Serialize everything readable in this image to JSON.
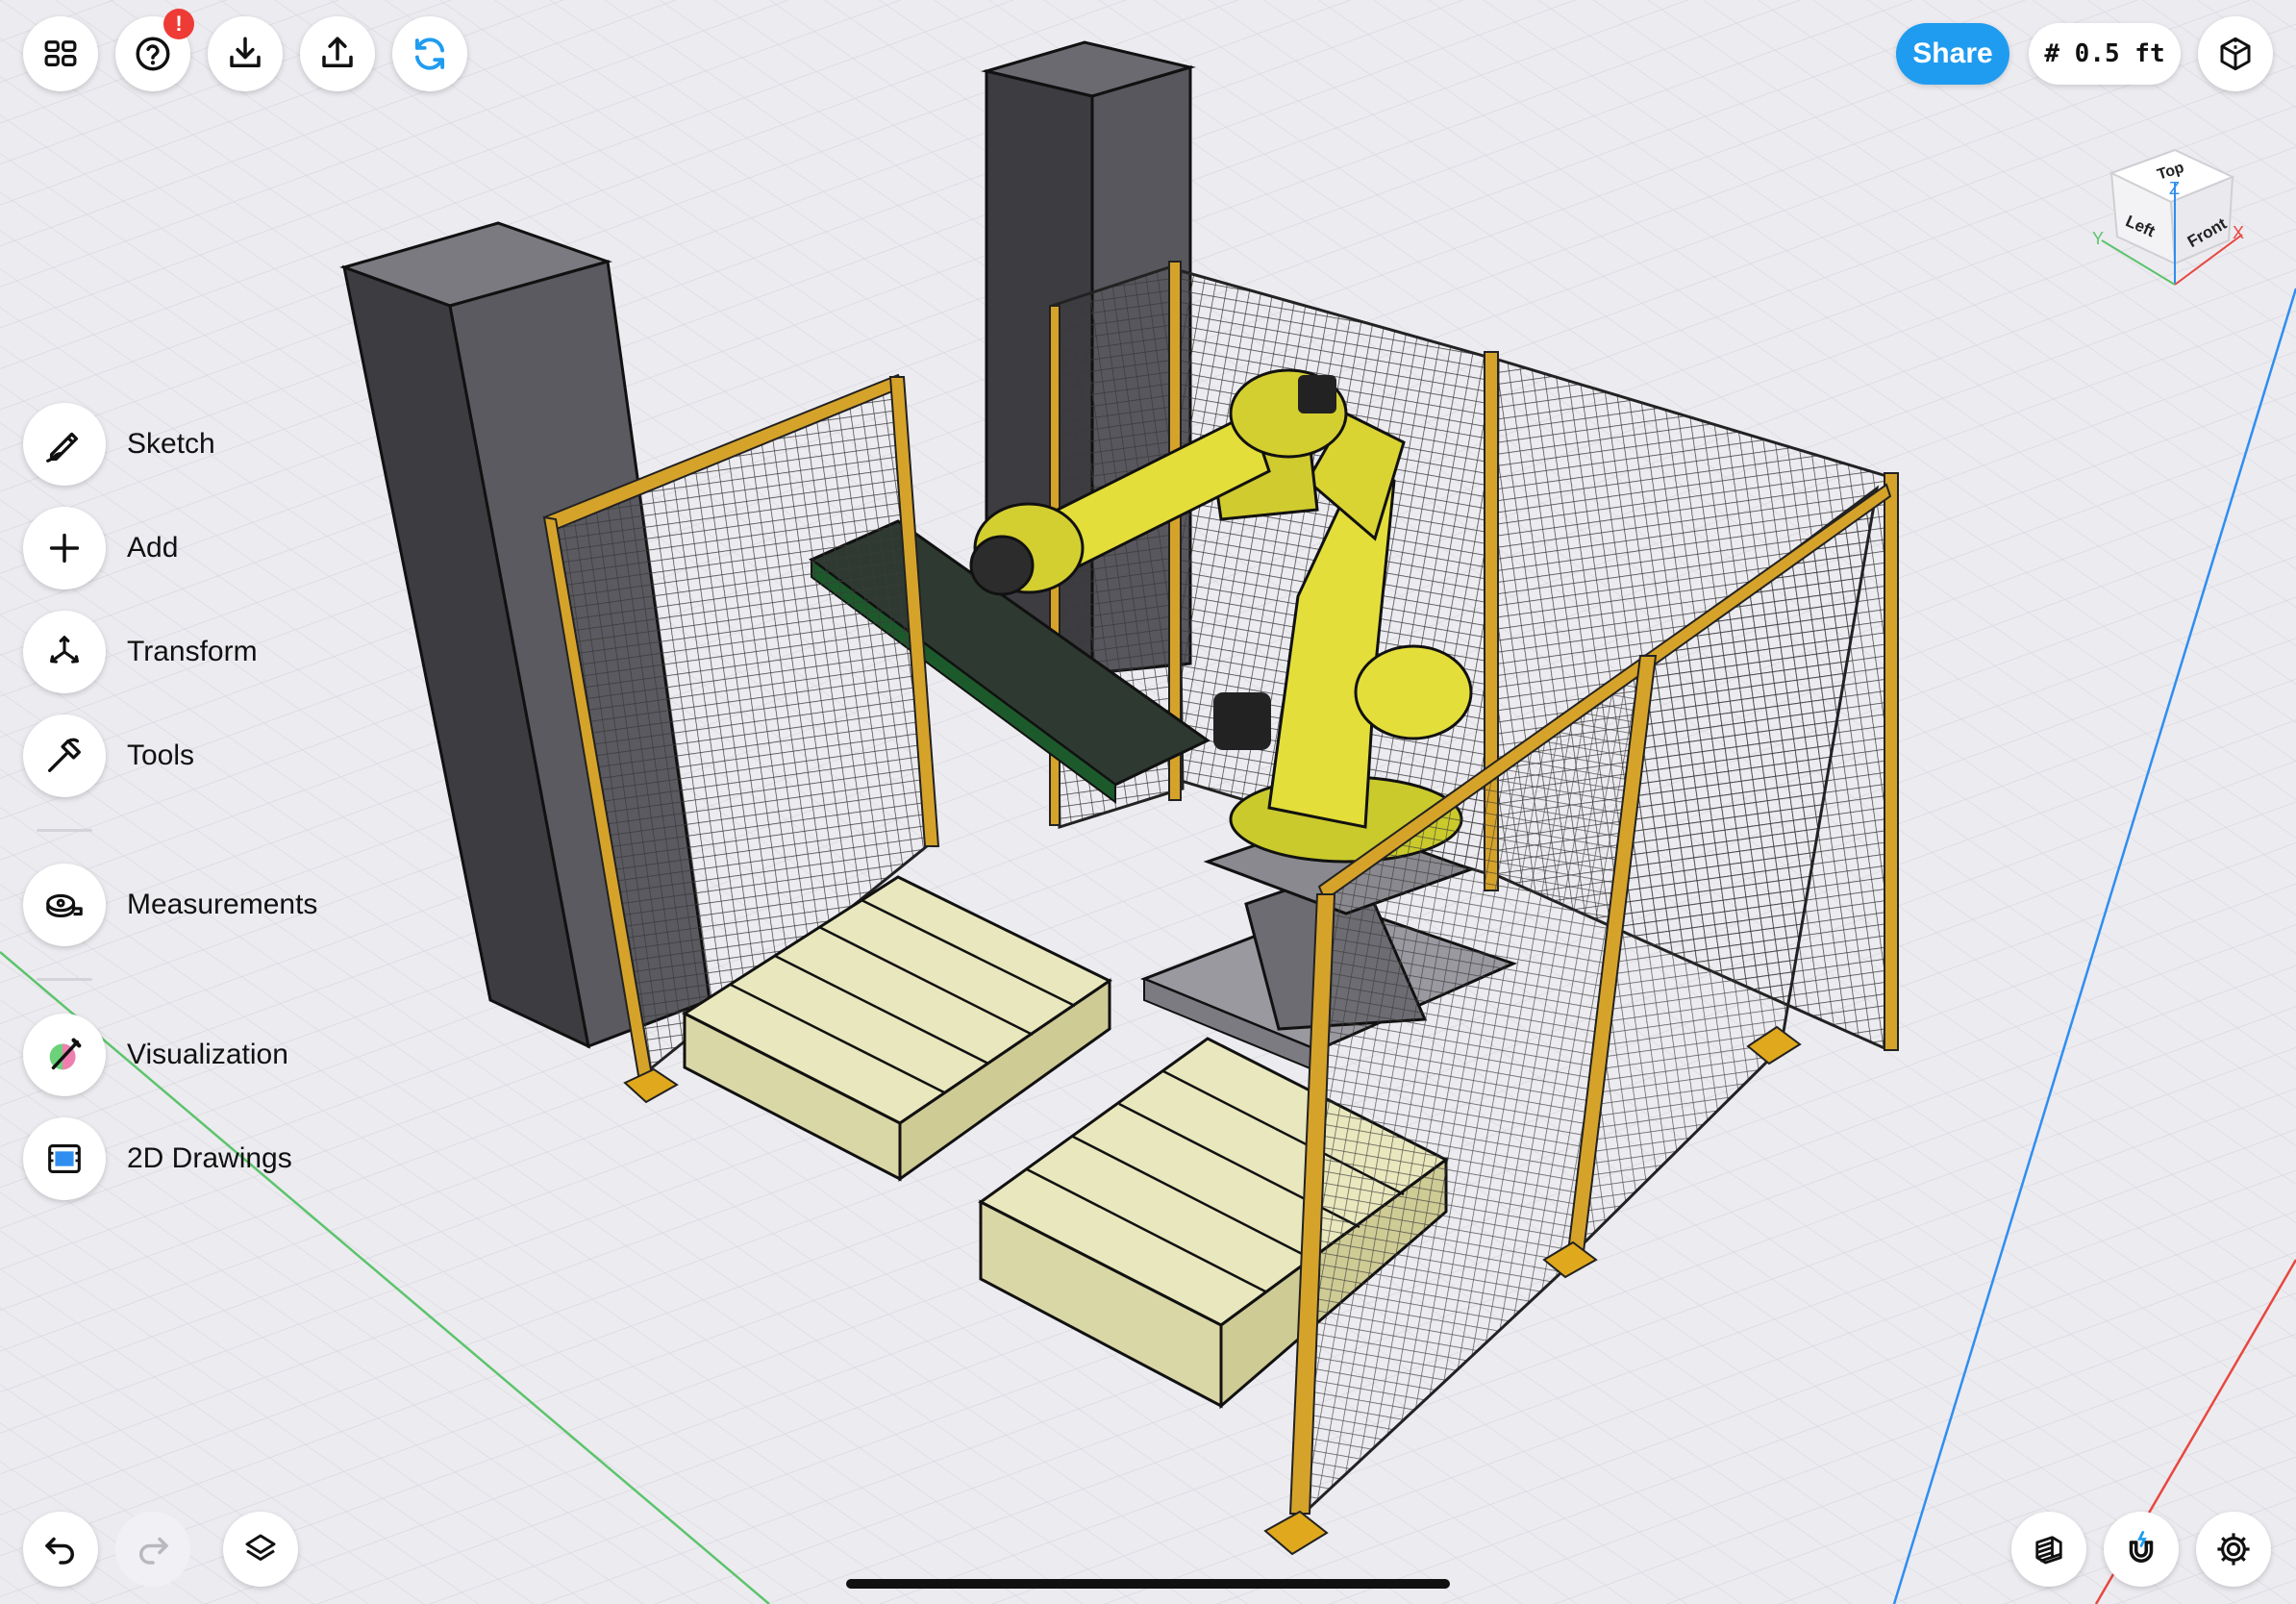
{
  "top_toolbar": {
    "left_buttons": [
      {
        "icon": "grid-icon"
      },
      {
        "icon": "help-icon",
        "badge": "!"
      },
      {
        "icon": "download-icon"
      },
      {
        "icon": "upload-icon"
      },
      {
        "icon": "sync-icon"
      }
    ],
    "share_label": "Share",
    "grid_size_label": "# 0.5 ft",
    "view_mode_icon": "cube-wireframe-icon"
  },
  "view_cube": {
    "faces": {
      "top": "Top",
      "left": "Left",
      "front": "Front"
    },
    "axes": {
      "x": "X",
      "y": "Y",
      "z": "Z"
    },
    "colors": {
      "x": "#e8473f",
      "y": "#5cc46b",
      "z": "#2f8ef0"
    }
  },
  "left_tools": [
    {
      "label": "Sketch",
      "icon": "pencil-icon"
    },
    {
      "label": "Add",
      "icon": "plus-icon"
    },
    {
      "label": "Transform",
      "icon": "transform-arrows-icon"
    },
    {
      "label": "Tools",
      "icon": "hammer-icon"
    },
    {
      "label": "Measurements",
      "icon": "tape-measure-icon"
    },
    {
      "label": "Visualization",
      "icon": "palette-icon"
    },
    {
      "label": "2D Drawings",
      "icon": "blueprint-icon"
    }
  ],
  "bottom_left": [
    {
      "icon": "undo-icon",
      "enabled": true
    },
    {
      "icon": "redo-icon",
      "enabled": false
    },
    {
      "icon": "layers-icon",
      "enabled": true
    }
  ],
  "bottom_right": [
    {
      "icon": "section-hatch-icon"
    },
    {
      "icon": "magnet-snap-icon"
    },
    {
      "icon": "settings-gear-icon"
    }
  ],
  "colors": {
    "accent": "#1f9cf0",
    "badge": "#ee3b35",
    "robot_yellow": "#e3de3a",
    "fence_frame": "#d6a32a",
    "pallet": "#e9e7bd",
    "column": "#4e4d52",
    "background": "#ecebf0"
  }
}
